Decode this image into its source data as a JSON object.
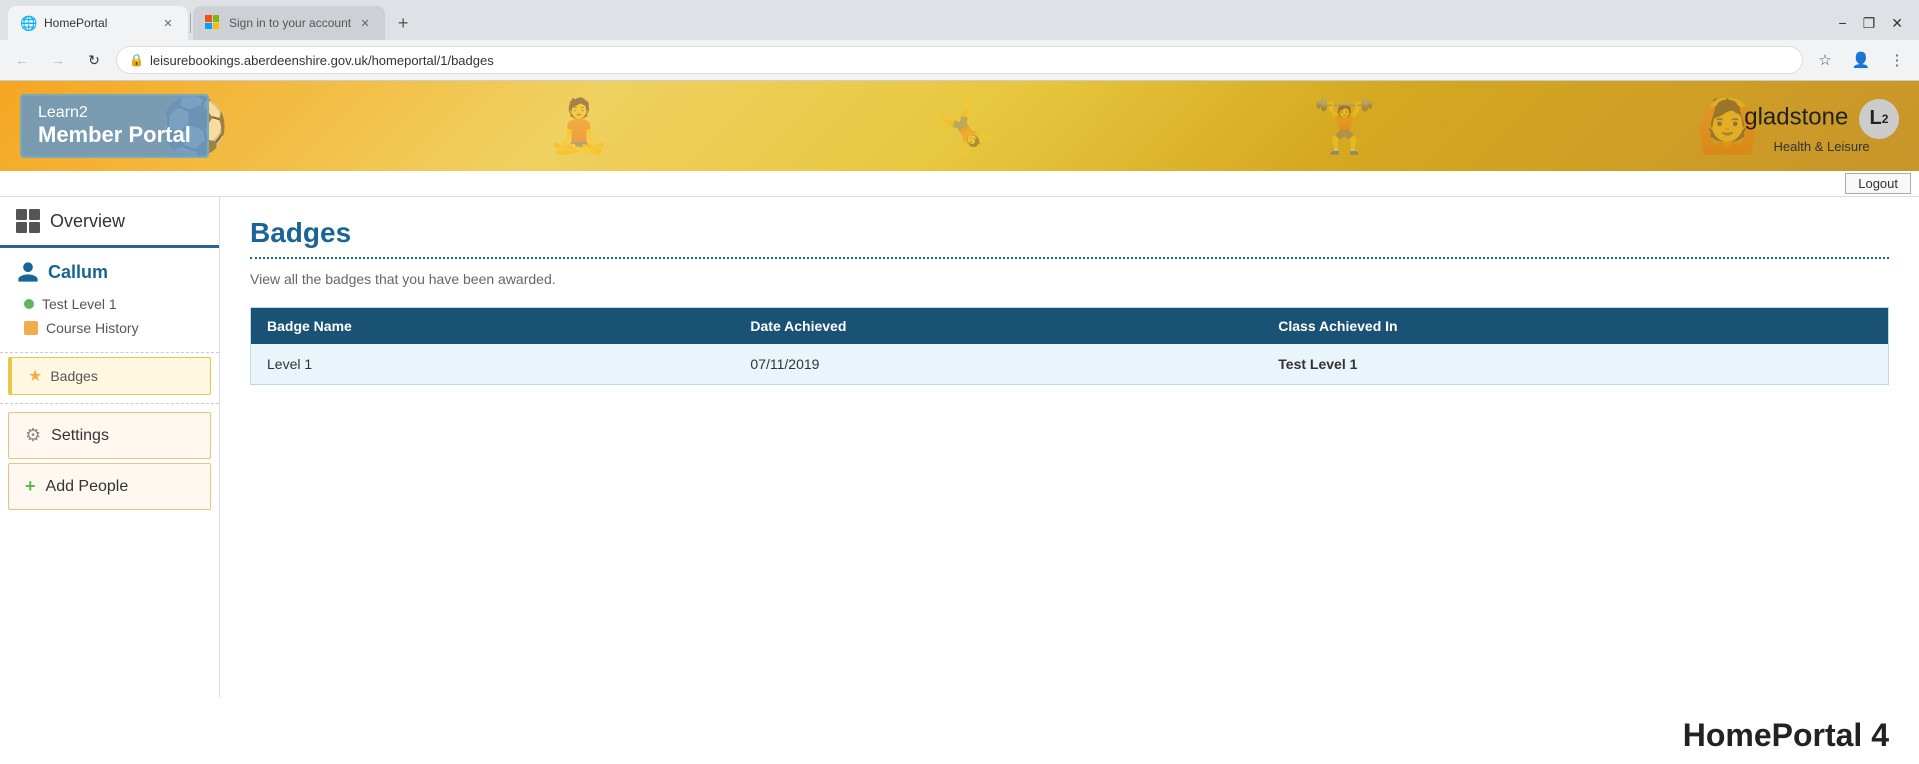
{
  "browser": {
    "tabs": [
      {
        "id": "tab1",
        "label": "HomePortal",
        "icon": "globe",
        "active": true
      },
      {
        "id": "tab2",
        "label": "Sign in to your account",
        "icon": "ms-logo",
        "active": false
      }
    ],
    "url": "leisurebookings.aberdeenshire.gov.uk/homeportal/1/badges",
    "window_controls": {
      "minimize": "−",
      "maximize": "❐",
      "close": "✕"
    }
  },
  "header": {
    "portal_line1": "Learn2",
    "portal_line2": "Member Portal",
    "logo_name": "gladstone",
    "logo_badge": "L",
    "logo_sup": "2",
    "logo_sub": "Health & Leisure",
    "logout_label": "Logout"
  },
  "sidebar": {
    "overview_label": "Overview",
    "user": {
      "name": "Callum",
      "sub_items": [
        {
          "type": "dot",
          "label": "Test Level 1"
        },
        {
          "type": "badge",
          "label": "Course History"
        }
      ]
    },
    "badges_label": "Badges",
    "settings_label": "Settings",
    "add_people_label": "Add People"
  },
  "content": {
    "page_title": "Badges",
    "page_description": "View all the badges that you have been awarded.",
    "table": {
      "headers": [
        "Badge Name",
        "Date Achieved",
        "Class Achieved In"
      ],
      "rows": [
        {
          "badge_name": "Level 1",
          "date_achieved": "07/11/2019",
          "class_achieved_in": "Test Level 1"
        }
      ]
    }
  },
  "footer": {
    "branding": "HomePortal 4"
  }
}
